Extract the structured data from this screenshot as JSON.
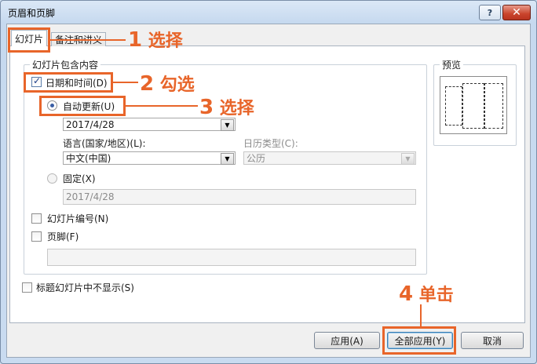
{
  "window": {
    "title": "页眉和页脚",
    "help_label": "?",
    "close_label": "✕"
  },
  "tabs": [
    {
      "label": "幻灯片"
    },
    {
      "label": "备注和讲义"
    }
  ],
  "group": {
    "legend": "幻灯片包含内容",
    "datetime_label": "日期和时间(D)",
    "datetime_checked": true,
    "auto_update_label": "自动更新(U)",
    "auto_update_selected": true,
    "date_value": "2017/4/28",
    "language_label": "语言(国家/地区)(L):",
    "language_value": "中文(中国)",
    "calendar_label": "日历类型(C):",
    "calendar_value": "公历",
    "fixed_label": "固定(X)",
    "fixed_value": "2017/4/28",
    "slide_number_label": "幻灯片编号(N)",
    "footer_label": "页脚(F)",
    "footer_value": ""
  },
  "preview": {
    "legend": "预览"
  },
  "title_slide_label": "标题幻灯片中不显示(S)",
  "buttons": {
    "apply": "应用(A)",
    "apply_all": "全部应用(Y)",
    "cancel": "取消"
  },
  "annotations": [
    {
      "num": "1",
      "text": "选择"
    },
    {
      "num": "2",
      "text": "勾选"
    },
    {
      "num": "3",
      "text": "选择"
    },
    {
      "num": "4",
      "text": "单击"
    }
  ],
  "colors": {
    "annotation": "#e8652a",
    "window_bg": "#cfe0f2"
  }
}
